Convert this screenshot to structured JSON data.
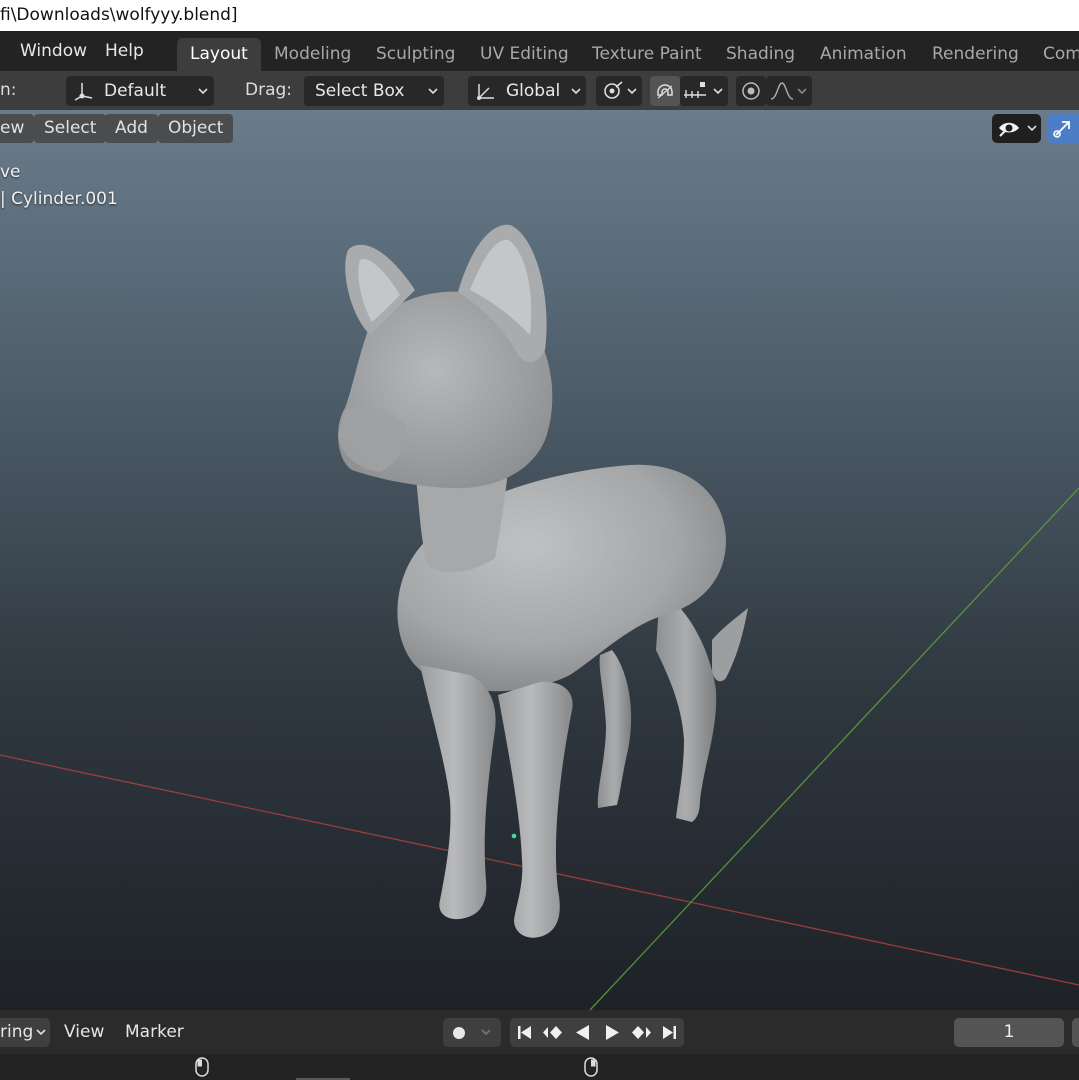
{
  "window": {
    "title_text": "fi\\Downloads\\wolfyyy.blend]"
  },
  "top_menu": {
    "window_label": "Window",
    "help_label": "Help"
  },
  "workspace_tabs": [
    {
      "label": "Layout",
      "active": true
    },
    {
      "label": "Modeling"
    },
    {
      "label": "Sculpting"
    },
    {
      "label": "UV Editing"
    },
    {
      "label": "Texture Paint"
    },
    {
      "label": "Shading"
    },
    {
      "label": "Animation"
    },
    {
      "label": "Rendering"
    },
    {
      "label": "Com"
    }
  ],
  "tool_header": {
    "orientation_label": "n:",
    "orientation_value": "Default",
    "drag_label": "Drag:",
    "drag_value": "Select Box",
    "transform_orientation_value": "Global",
    "icons": [
      "orientation-icon",
      "transform-orientation-icon",
      "pivot-icon",
      "snap-magnet-icon",
      "snap-increment-icon",
      "proportional-edit-icon",
      "falloff-curve-icon"
    ]
  },
  "viewport": {
    "menu": {
      "view_label": "ew",
      "select_label": "Select",
      "add_label": "Add",
      "object_label": "Object"
    },
    "overlay_line1": "ve",
    "overlay_line2": "| Cylinder.001",
    "icons": [
      "visibility-eye-icon",
      "gizmo-toggle-icon"
    ],
    "colors": {
      "x_axis": "#b04040",
      "y_axis": "#5a9e3a",
      "origin_dot": "#3fe0a0",
      "mesh": "#a4a6a8"
    }
  },
  "timeline": {
    "playback_label": "ring",
    "view_label": "View",
    "marker_label": "Marker",
    "current_frame": "1",
    "icons": [
      "record-icon",
      "jump-start-icon",
      "prev-keyframe-icon",
      "play-reverse-icon",
      "play-icon",
      "next-keyframe-icon",
      "jump-end-icon"
    ]
  },
  "statusbar": {
    "icons": [
      "mouse-left-icon",
      "mouse-middle-icon"
    ]
  }
}
